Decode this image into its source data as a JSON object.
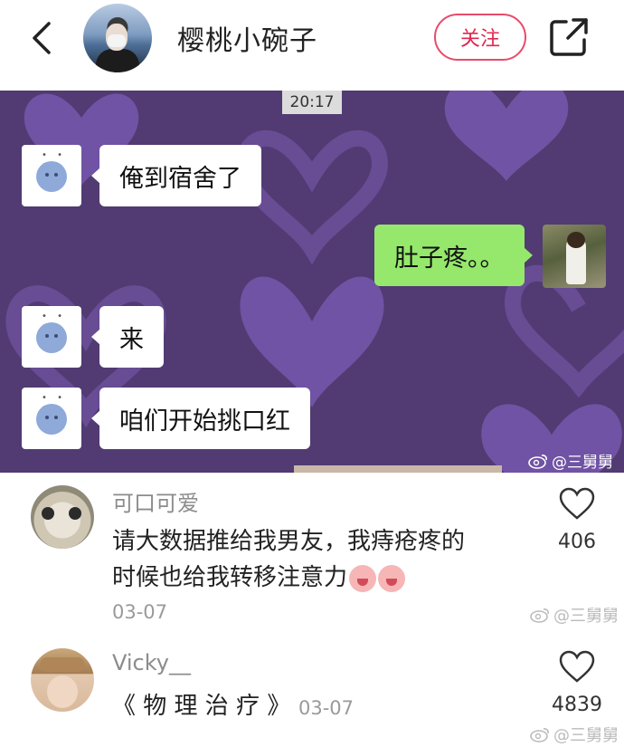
{
  "header": {
    "title": "樱桃小碗子",
    "follow_label": "关注",
    "back_icon": "back-arrow-icon",
    "share_icon": "share-icon"
  },
  "chat": {
    "time": "20:17",
    "bg_color": "#513b72",
    "messages": [
      {
        "side": "left",
        "text": "俺到宿舍了"
      },
      {
        "side": "right",
        "text": "肚子疼。。"
      },
      {
        "side": "left",
        "text": "来"
      },
      {
        "side": "left",
        "text": "咱们开始挑口红"
      }
    ],
    "watermark": "@三舅舅"
  },
  "comments": [
    {
      "user": "可口可爱",
      "text_line1": "请大数据推给我男友，我痔疮疼的",
      "text_line2": "时候也给我转移注意力",
      "date": "03-07",
      "likes": "406",
      "watermark": "@三舅舅"
    },
    {
      "user": "Vicky__",
      "text": "《 物 理 治 疗 》",
      "date": "03-07",
      "likes": "4839",
      "watermark": "@三舅舅"
    }
  ],
  "colors": {
    "accent": "#e0284f",
    "chat_green": "#95e86c"
  }
}
